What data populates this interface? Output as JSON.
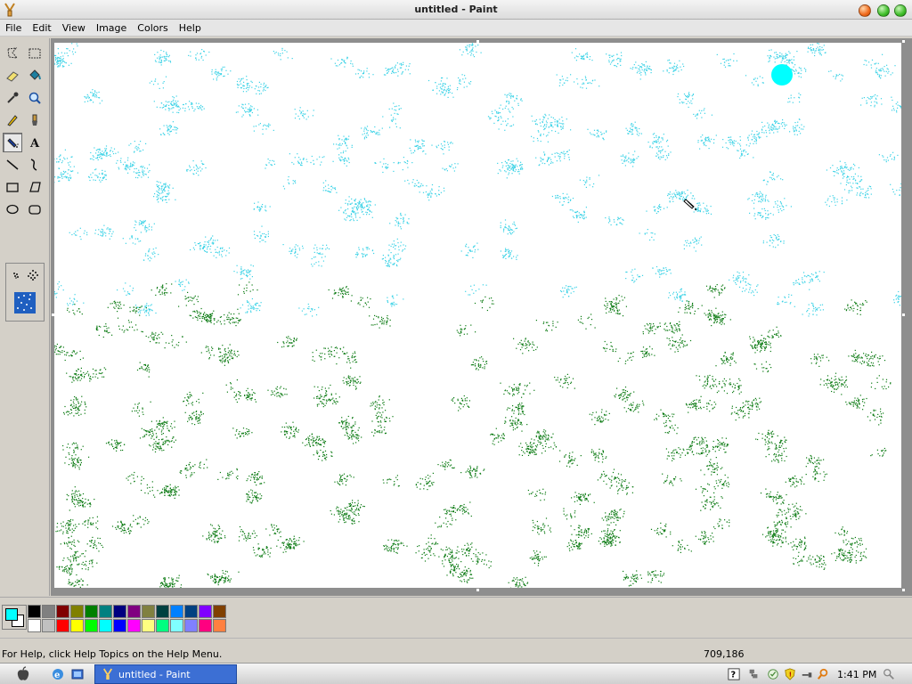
{
  "window": {
    "title": "untitled - Paint"
  },
  "menu": [
    "File",
    "Edit",
    "View",
    "Image",
    "Colors",
    "Help"
  ],
  "tools": [
    "free-form-select",
    "rect-select",
    "eraser",
    "fill",
    "color-picker",
    "magnifier",
    "pencil",
    "brush",
    "airbrush",
    "text",
    "line",
    "curve",
    "rectangle",
    "polygon",
    "ellipse",
    "rounded-rectangle"
  ],
  "active_tool": "airbrush",
  "colors": {
    "foreground": "#00ffff",
    "background": "#ffffff",
    "sky_spray": "#3ad2e6",
    "grass_spray": "#0a7a12",
    "palette_row1": [
      "#000000",
      "#808080",
      "#800000",
      "#808000",
      "#008000",
      "#008080",
      "#000080",
      "#800080",
      "#808040",
      "#004040",
      "#0080ff",
      "#004080",
      "#8000ff",
      "#804000"
    ],
    "palette_row2": [
      "#ffffff",
      "#c0c0c0",
      "#ff0000",
      "#ffff00",
      "#00ff00",
      "#00ffff",
      "#0000ff",
      "#ff00ff",
      "#ffff80",
      "#00ff80",
      "#80ffff",
      "#8080ff",
      "#ff0080",
      "#ff8040"
    ]
  },
  "status": {
    "help_text": "For Help, click Help Topics on the Help Menu.",
    "coords": "709,186"
  },
  "taskbar": {
    "task_label": "untitled - Paint",
    "clock": "1:41 PM"
  }
}
